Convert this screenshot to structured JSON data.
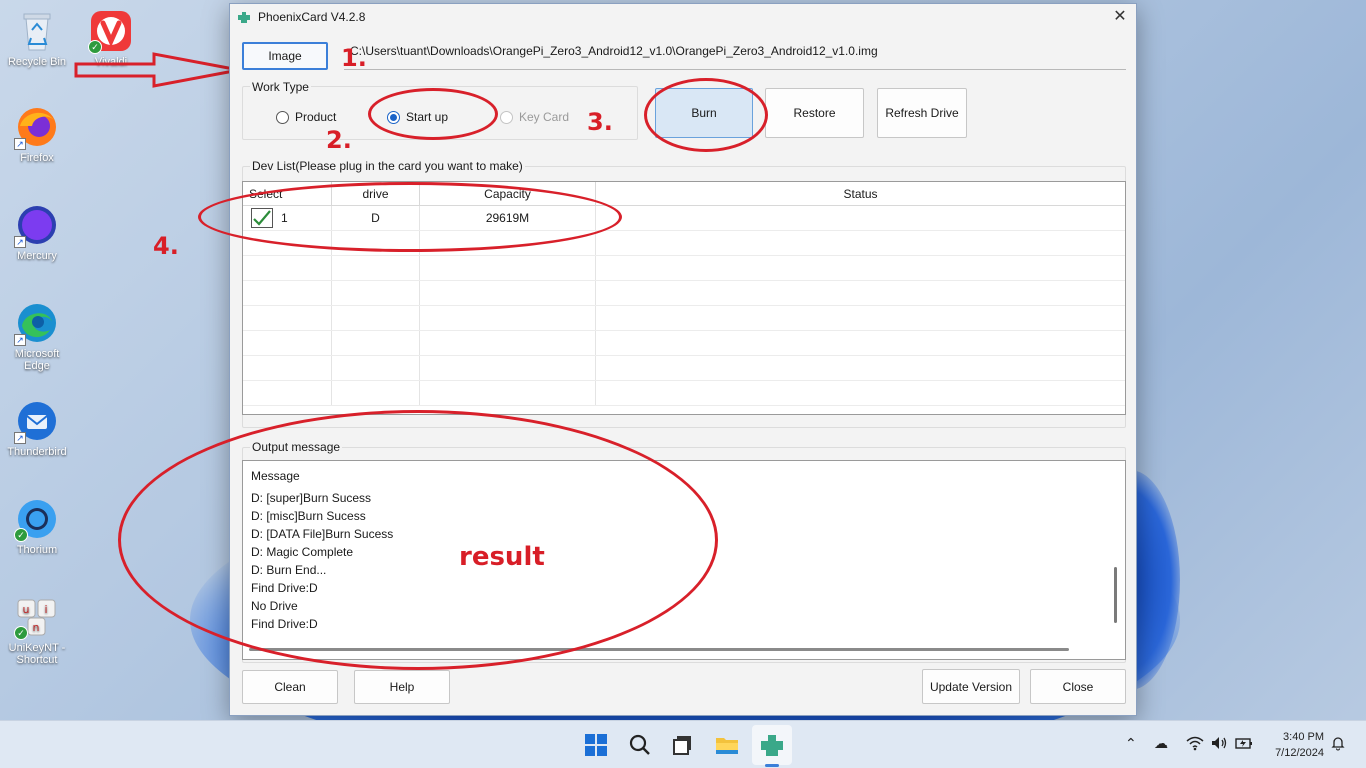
{
  "desktop": {
    "icons": [
      {
        "label": "Recycle Bin",
        "icon": "recycle-bin-icon"
      },
      {
        "label": "Vivaldi",
        "icon": "vivaldi-icon"
      },
      {
        "label": "Firefox",
        "icon": "firefox-icon"
      },
      {
        "label": "Mercury",
        "icon": "mercury-icon"
      },
      {
        "label": "Microsoft Edge",
        "icon": "edge-icon"
      },
      {
        "label": "Thunderbird",
        "icon": "thunderbird-icon"
      },
      {
        "label": "Thorium",
        "icon": "thorium-icon"
      },
      {
        "label": "UniKeyNT - Shortcut",
        "icon": "unikey-icon"
      }
    ]
  },
  "annotations": {
    "step1": "1.",
    "step2": "2.",
    "step3": "3.",
    "step4": "4.",
    "result": "result",
    "color": "#d81e27"
  },
  "window": {
    "title": "PhoenixCard V4.2.8",
    "image_button": "Image",
    "image_path": "C:\\Users\\tuant\\Downloads\\OrangePi_Zero3_Android12_v1.0\\OrangePi_Zero3_Android12_v1.0.img",
    "work_type": {
      "label": "Work Type",
      "options": [
        {
          "label": "Product",
          "checked": false,
          "disabled": false
        },
        {
          "label": "Start up",
          "checked": true,
          "disabled": false
        },
        {
          "label": "Key Card",
          "checked": false,
          "disabled": true
        }
      ]
    },
    "actions": {
      "burn": "Burn",
      "restore": "Restore",
      "refresh": "Refresh Drive"
    },
    "dev_list": {
      "label": "Dev List(Please plug in the card you want to make)",
      "columns": [
        "Select",
        "drive",
        "Capacity",
        "Status"
      ],
      "rows": [
        {
          "select": "1",
          "checked": true,
          "drive": "D",
          "capacity": "29619M",
          "status": ""
        }
      ]
    },
    "output": {
      "label": "Output message",
      "header": "Message",
      "lines": [
        "D: [super]Burn Sucess",
        "D: [misc]Burn Sucess",
        "D: [DATA File]Burn Sucess",
        "D: Magic Complete",
        "D: Burn End...",
        "Find Drive:D",
        "No Drive",
        "Find Drive:D"
      ]
    },
    "footer": {
      "clean": "Clean",
      "help": "Help",
      "update": "Update Version",
      "close": "Close"
    }
  },
  "taskbar": {
    "apps": [
      "windows-start-icon",
      "search-icon",
      "task-view-icon",
      "file-explorer-icon",
      "phoenixcard-icon"
    ],
    "clock_time": "3:40 PM",
    "clock_date": "7/12/2024"
  }
}
